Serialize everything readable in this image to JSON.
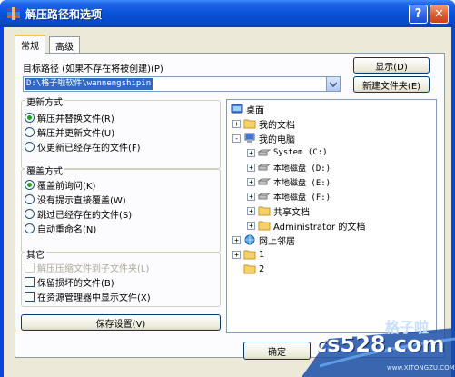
{
  "window": {
    "title": "解压路径和选项",
    "help_label": "?",
    "close_label": "✕"
  },
  "tabs": [
    {
      "label": "常规",
      "active": true
    },
    {
      "label": "高级",
      "active": false
    }
  ],
  "target": {
    "label": "目标路径 (如果不存在将被创建)(P)",
    "value": "D:\\格子啦软件\\wannengshipin",
    "show_button": "显示(D)",
    "new_folder_button": "新建文件夹(E)"
  },
  "update_mode": {
    "title": "更新方式",
    "options": [
      {
        "label": "解压并替换文件(R)",
        "checked": true
      },
      {
        "label": "解压并更新文件(U)",
        "checked": false
      },
      {
        "label": "仅更新已经存在的文件(F)",
        "checked": false
      }
    ]
  },
  "overwrite_mode": {
    "title": "覆盖方式",
    "options": [
      {
        "label": "覆盖前询问(K)",
        "checked": true
      },
      {
        "label": "没有提示直接覆盖(W)",
        "checked": false
      },
      {
        "label": "跳过已经存在的文件(S)",
        "checked": false
      },
      {
        "label": "自动重命名(N)",
        "checked": false
      }
    ]
  },
  "misc": {
    "title": "其它",
    "options": [
      {
        "label": "解压压缩文件到子文件夹(L)",
        "checked": false,
        "disabled": true
      },
      {
        "label": "保留损坏的文件(B)",
        "checked": false,
        "disabled": false
      },
      {
        "label": "在资源管理器中显示文件(X)",
        "checked": false,
        "disabled": false
      }
    ]
  },
  "save_settings_button": "保存设置(V)",
  "ok_button": "确定",
  "tree": {
    "root": "桌面",
    "my_documents": "我的文档",
    "my_computer": "我的电脑",
    "drives": [
      "System (C:)",
      "本地磁盘 (D:)",
      "本地磁盘 (E:)",
      "本地磁盘 (F:)"
    ],
    "shared_docs": "共享文档",
    "admin_docs": "Administrator 的文档",
    "network": "网上邻居",
    "folder1": "1",
    "folder2": "2"
  },
  "watermark": {
    "text": "cs528.com",
    "brand": "格子啦",
    "url": "www.XITONGZU.COM"
  },
  "colors": {
    "title_bar": "#0853d6",
    "dialog_bg": "#ece9d8",
    "selection": "#316ac5",
    "radio_dot": "#21a121"
  }
}
